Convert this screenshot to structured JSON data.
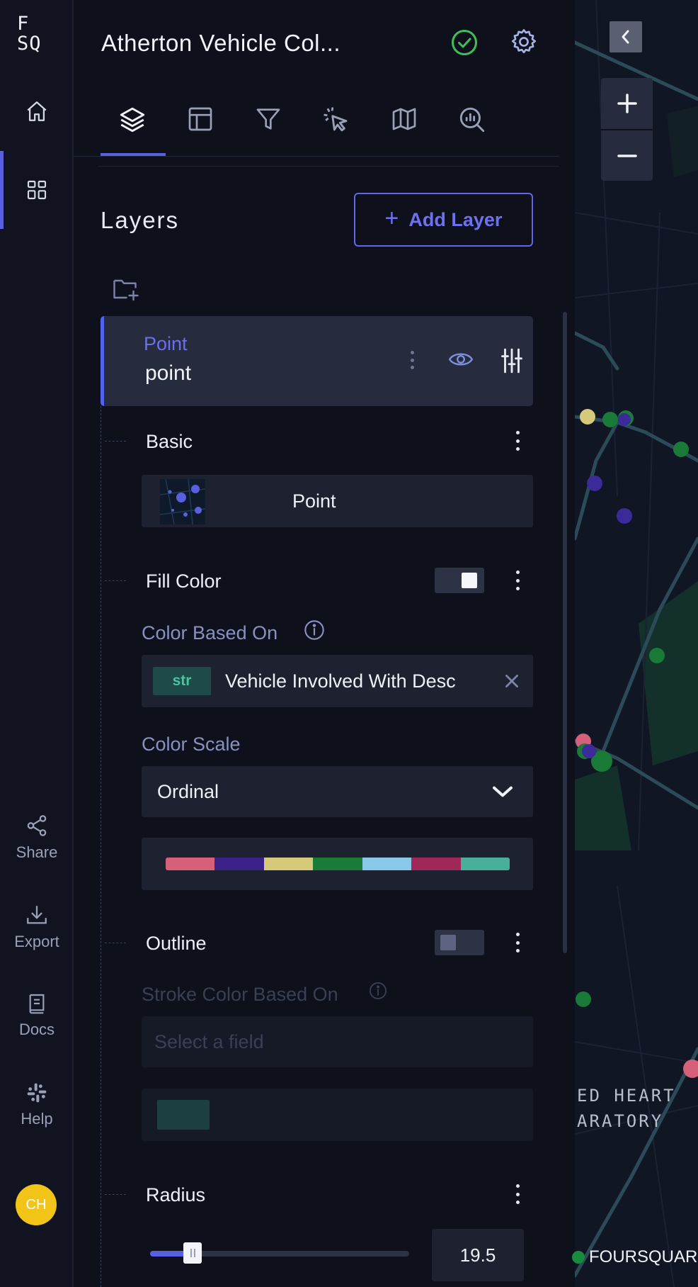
{
  "app": {
    "logo_line1": "F",
    "logo_line2": "SQ",
    "title": "Atherton Vehicle Col..."
  },
  "rail": {
    "items": [
      {
        "icon": "home-icon",
        "label": ""
      },
      {
        "icon": "dashboard-icon",
        "label": ""
      },
      {
        "icon": "share-icon",
        "label": "Share"
      },
      {
        "icon": "export-icon",
        "label": "Export"
      },
      {
        "icon": "docs-icon",
        "label": "Docs"
      },
      {
        "icon": "help-icon",
        "label": "Help"
      }
    ],
    "avatar_initials": "CH"
  },
  "tabs": [
    {
      "name": "layers",
      "icon": "layers-icon",
      "active": true
    },
    {
      "name": "layout",
      "icon": "layout-icon"
    },
    {
      "name": "filters",
      "icon": "filter-icon"
    },
    {
      "name": "interactions",
      "icon": "pointer-click-icon"
    },
    {
      "name": "base-map",
      "icon": "map-icon"
    },
    {
      "name": "analysis",
      "icon": "search-analysis-icon"
    }
  ],
  "layers_panel": {
    "heading": "Layers",
    "add_button": "Add Layer",
    "add_button_icon": "+",
    "layer": {
      "type": "Point",
      "name": "point"
    }
  },
  "basic": {
    "title": "Basic",
    "layer_type": "Point"
  },
  "fill_color": {
    "title": "Fill Color",
    "enabled": true,
    "based_on_label": "Color Based On",
    "field_type": "str",
    "field_name": "Vehicle Involved With Desc",
    "scale_label": "Color Scale",
    "scale_value": "Ordinal",
    "palette": [
      "#d6607a",
      "#3a228a",
      "#d6c97a",
      "#1a7a38",
      "#88c8e8",
      "#a02858",
      "#48b09a"
    ]
  },
  "outline": {
    "title": "Outline",
    "enabled": false,
    "stroke_label": "Stroke Color Based On",
    "stroke_placeholder": "Select a field",
    "stroke_color": "#1c3f42"
  },
  "radius": {
    "title": "Radius",
    "value": "19.5",
    "slider_fraction": 0.165
  },
  "map": {
    "labels": [
      "ED HEART",
      "ARATORY"
    ],
    "attribution": "FOURSQUARE",
    "point_colors": [
      "#d6c97a",
      "#1a7a38",
      "#3a2a9a",
      "#d6607a"
    ]
  },
  "colors": {
    "accent": "#5a5fe0",
    "success": "#3fbf5a",
    "panel_bg": "#0e111c"
  }
}
